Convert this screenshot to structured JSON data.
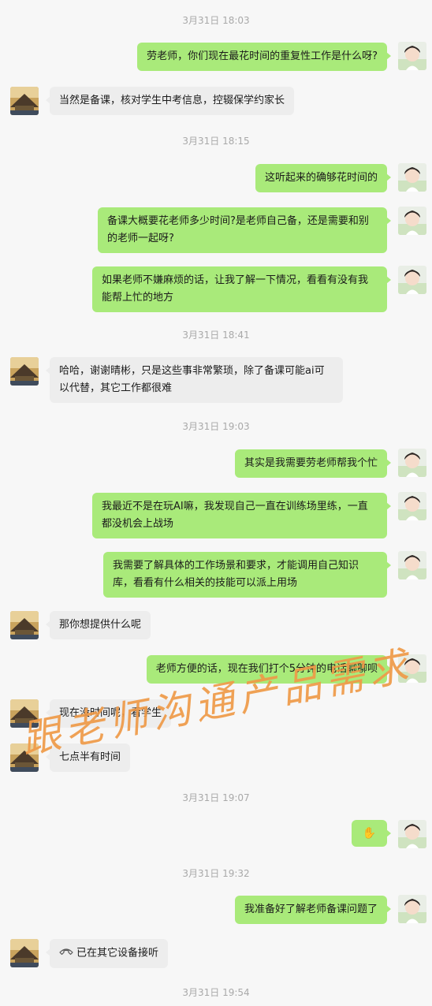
{
  "timestamps": [
    "3月31日 18:03",
    "3月31日 18:15",
    "3月31日 18:41",
    "3月31日 19:03",
    "3月31日 19:07",
    "3月31日 19:32",
    "3月31日 19:54"
  ],
  "messages": [
    {
      "from": "me",
      "text": "劳老师，你们现在最花时间的重复性工作是什么呀?"
    },
    {
      "from": "other",
      "text": "当然是备课，核对学生中考信息，控辍保学约家长"
    },
    {
      "from": "me",
      "text": "这听起来的确够花时间的"
    },
    {
      "from": "me",
      "text": "备课大概要花老师多少时间?是老师自己备，还是需要和别的老师一起呀?"
    },
    {
      "from": "me",
      "text": "如果老师不嫌麻烦的话，让我了解一下情况，看看有没有我能帮上忙的地方"
    },
    {
      "from": "other",
      "text": "哈哈，谢谢晴彬，只是这些事非常繁琐，除了备课可能ai可以代替，其它工作都很难"
    },
    {
      "from": "me",
      "text": "其实是我需要劳老师帮我个忙"
    },
    {
      "from": "me",
      "text": "我最近不是在玩AI嘛，我发现自己一直在训练场里练，一直都没机会上战场"
    },
    {
      "from": "me",
      "text": "我需要了解具体的工作场景和要求，才能调用自己知识库，看看有什么相关的技能可以派上用场"
    },
    {
      "from": "other",
      "text": "那你想提供什么呢"
    },
    {
      "from": "me",
      "text": "老师方便的话，现在我们打个5分钟的电话聊聊呗"
    },
    {
      "from": "other",
      "text": "现在没时间呢，看学生"
    },
    {
      "from": "other",
      "text": "七点半有时间"
    },
    {
      "from": "me",
      "text": "✋"
    },
    {
      "from": "me",
      "text": "我准备好了解老师备课问题了"
    },
    {
      "from": "other",
      "text": "已在其它设备接听",
      "icon": "phone-hangup-icon"
    }
  ],
  "watermark": "跟老师沟通产品需求",
  "colors": {
    "background": "#f7f7f7",
    "me_bubble": "#a9ea7a",
    "other_bubble": "#ededed",
    "timestamp": "#a9a9a9",
    "watermark": "#ef9a48"
  }
}
